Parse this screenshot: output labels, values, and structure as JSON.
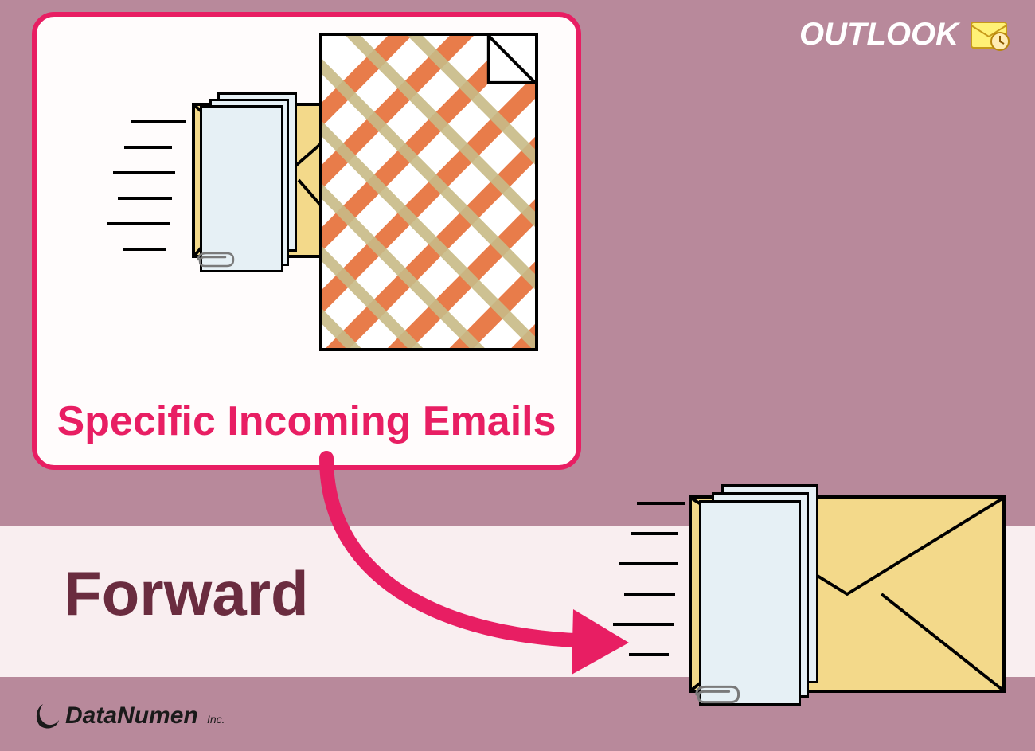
{
  "card": {
    "label": "Specific Incoming Emails"
  },
  "action": {
    "label": "Forward"
  },
  "brand": {
    "outlook": "OUTLOOK",
    "footer_bold": "DataNumen",
    "footer_sub": "Inc."
  },
  "colors": {
    "bg": "#b8899b",
    "accent": "#e81e63",
    "band": "#f9eef0",
    "dark": "#6a2c3f",
    "envelope": "#f3d98a",
    "paper": "#e6f0f5"
  },
  "diagram": {
    "source": "incoming-email-with-attachment",
    "target": "forwarded-email",
    "relation": "forward"
  }
}
